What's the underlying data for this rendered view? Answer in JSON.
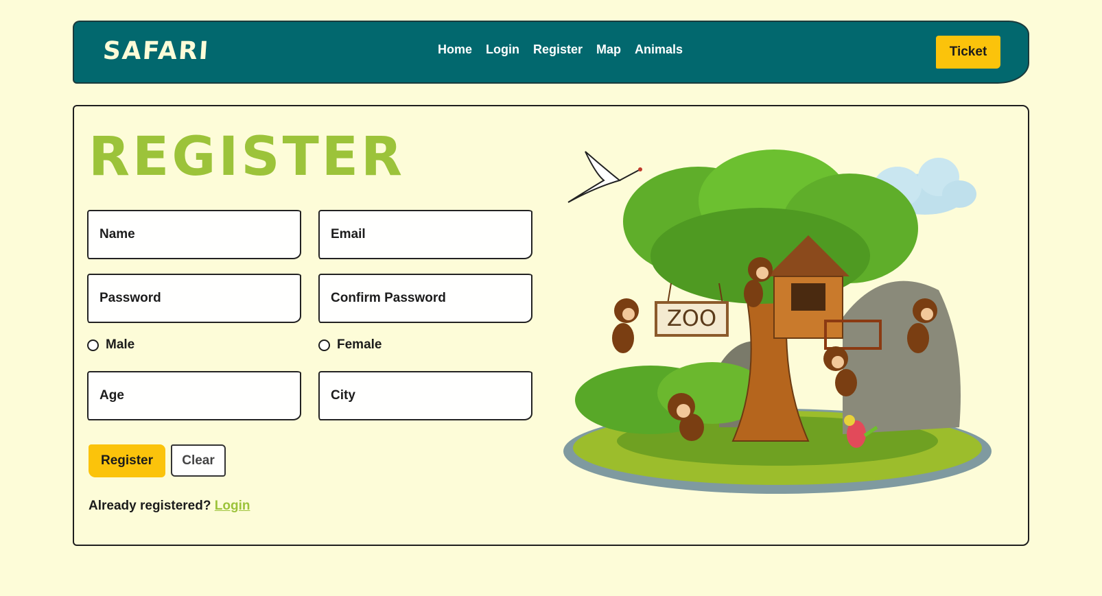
{
  "navbar": {
    "logo": "SAFARI",
    "links": [
      "Home",
      "Login",
      "Register",
      "Map",
      "Animals"
    ],
    "ticket_label": "Ticket"
  },
  "form": {
    "title": "REGISTER",
    "fields": {
      "name": "Name",
      "email": "Email",
      "password": "Password",
      "confirm_password": "Confirm Password",
      "age": "Age",
      "city": "City"
    },
    "gender": {
      "male": "Male",
      "female": "Female"
    },
    "register_label": "Register",
    "clear_label": "Clear",
    "already_text": "Already registered?",
    "login_link": "Login"
  },
  "illustration": {
    "sign_text": "ZOO"
  },
  "colors": {
    "background": "#fdfcd8",
    "navbar": "#02686e",
    "accent_yellow": "#fbc30b",
    "accent_green": "#9cc33a"
  }
}
